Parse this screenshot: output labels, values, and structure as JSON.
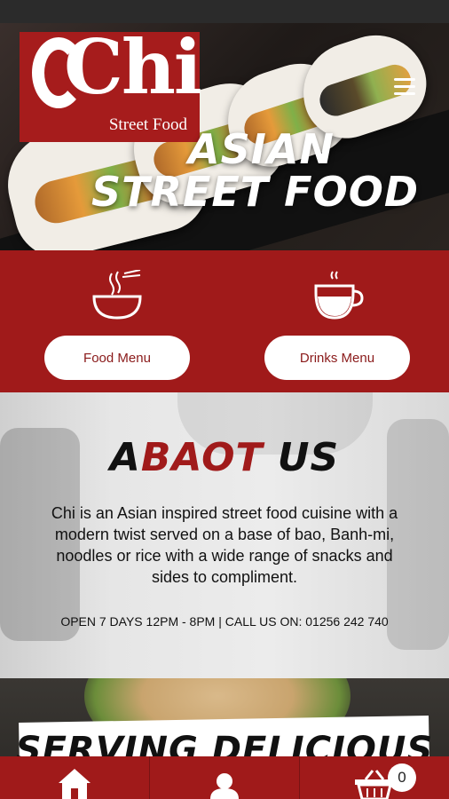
{
  "brand": {
    "name": "Chi",
    "tagline": "Street Food"
  },
  "hero": {
    "title_line1": "ASIAN",
    "title_line2": "STREET FOOD"
  },
  "menus": {
    "food_label": "Food Menu",
    "drinks_label": "Drinks Menu"
  },
  "about": {
    "title_prefix": "A",
    "title_red": "BAOT",
    "title_suffix": " US",
    "text": "Chi is an Asian inspired street food cuisine with a modern twist served on a base of bao, Banh-mi, noodles or rice with a wide range of snacks and sides to compliment.",
    "hours": "OPEN 7 DAYS 12PM - 8PM | CALL US ON: 01256 242 740"
  },
  "promo": {
    "heading": "SERVING DELICIOUS"
  },
  "nav": {
    "cart_count": "0"
  },
  "colors": {
    "brand_red": "#a01a1a",
    "white": "#ffffff"
  }
}
